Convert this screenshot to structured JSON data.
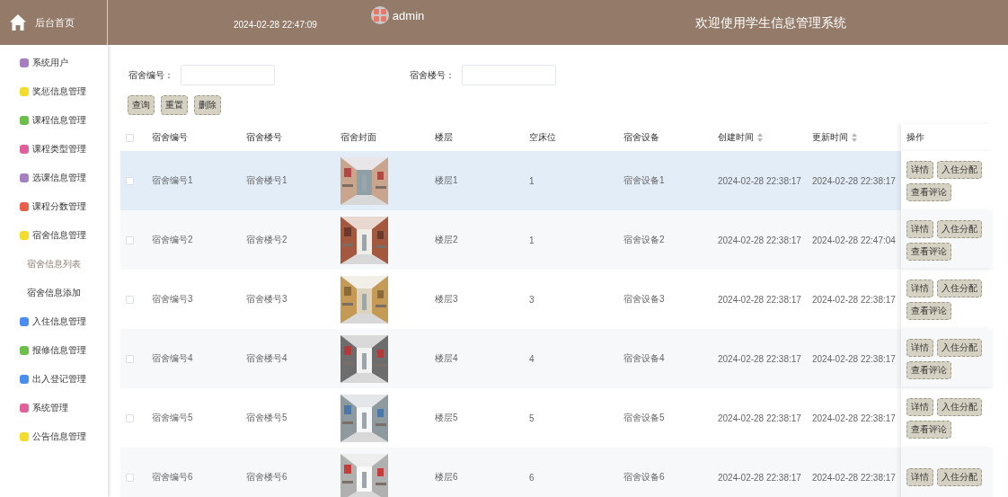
{
  "header": {
    "home_label": "后台首页",
    "datetime": "2024-02-28 22:47:09",
    "user": "admin",
    "title": "欢迎使用学生信息管理系统"
  },
  "sidebar": {
    "items": [
      {
        "label": "系统用户",
        "color": "#a57fc0"
      },
      {
        "label": "奖惩信息管理",
        "color": "#f2dc2e"
      },
      {
        "label": "课程信息管理",
        "color": "#6cc04a"
      },
      {
        "label": "课程类型管理",
        "color": "#e0609e"
      },
      {
        "label": "选课信息管理",
        "color": "#a57fc0"
      },
      {
        "label": "课程分数管理",
        "color": "#e8604c"
      },
      {
        "label": "宿舍信息管理",
        "color": "#f2dc2e",
        "children": [
          {
            "label": "宿舍信息列表",
            "selected": true
          },
          {
            "label": "宿舍信息添加",
            "selected": false
          }
        ]
      },
      {
        "label": "入住信息管理",
        "color": "#4a8df0"
      },
      {
        "label": "报修信息管理",
        "color": "#6cc04a"
      },
      {
        "label": "出入登记管理",
        "color": "#4a8df0"
      },
      {
        "label": "系统管理",
        "color": "#e0609e"
      },
      {
        "label": "公告信息管理",
        "color": "#f2dc2e"
      }
    ]
  },
  "search": {
    "fields": [
      {
        "label": "宿舍编号："
      },
      {
        "label": "宿舍楼号："
      }
    ],
    "buttons": [
      "查询",
      "重置",
      "删除"
    ]
  },
  "table": {
    "header_checked": false,
    "columns": [
      {
        "label": "宿舍编号",
        "sortable": false
      },
      {
        "label": "宿舍楼号",
        "sortable": false
      },
      {
        "label": "宿舍封面",
        "sortable": false
      },
      {
        "label": "楼层",
        "sortable": false
      },
      {
        "label": "空床位",
        "sortable": false
      },
      {
        "label": "宿舍设备",
        "sortable": false
      },
      {
        "label": "创建时间",
        "sortable": true
      },
      {
        "label": "更新时间",
        "sortable": true
      },
      {
        "label": "操作",
        "sortable": false
      }
    ],
    "rows": [
      {
        "checked": false,
        "highlighted": true,
        "cells": [
          "宿舍编号1",
          "宿舍楼号1",
          {
            "kind": "picture"
          },
          "楼层1",
          "1",
          "宿舍设备1",
          "2024-02-28 22:38:17",
          "2024-02-28 22:38:17",
          {
            "actions": [
              "详情",
              "入住分配",
              "查看评论"
            ]
          }
        ]
      },
      {
        "checked": false,
        "highlighted": false,
        "cells": [
          "宿舍编号2",
          "宿舍楼号2",
          {
            "kind": "picture"
          },
          "楼层2",
          "1",
          "宿舍设备2",
          "2024-02-28 22:38:17",
          "2024-02-28 22:47:04",
          {
            "actions": [
              "详情",
              "入住分配",
              "查看评论"
            ]
          }
        ]
      },
      {
        "checked": false,
        "highlighted": false,
        "cells": [
          "宿舍编号3",
          "宿舍楼号3",
          {
            "kind": "picture"
          },
          "楼层3",
          "3",
          "宿舍设备3",
          "2024-02-28 22:38:17",
          "2024-02-28 22:38:17",
          {
            "actions": [
              "详情",
              "入住分配",
              "查看评论"
            ]
          }
        ]
      },
      {
        "checked": false,
        "highlighted": false,
        "cells": [
          "宿舍编号4",
          "宿舍楼号4",
          {
            "kind": "picture"
          },
          "楼层4",
          "4",
          "宿舍设备4",
          "2024-02-28 22:38:17",
          "2024-02-28 22:38:17",
          {
            "actions": [
              "详情",
              "入住分配",
              "查看评论"
            ]
          }
        ]
      },
      {
        "checked": false,
        "highlighted": false,
        "cells": [
          "宿舍编号5",
          "宿舍楼号5",
          {
            "kind": "picture"
          },
          "楼层5",
          "5",
          "宿舍设备5",
          "2024-02-28 22:38:17",
          "2024-02-28 22:38:17",
          {
            "actions": [
              "详情",
              "入住分配",
              "查看评论"
            ]
          }
        ]
      },
      {
        "checked": false,
        "highlighted": false,
        "cells": [
          "宿舍编号6",
          "宿舍楼号6",
          {
            "kind": "picture"
          },
          "楼层6",
          "6",
          "宿舍设备6",
          "2024-02-28 22:38:17",
          "2024-02-28 22:38:17",
          {
            "actions": [
              "详情",
              "入住分配"
            ]
          }
        ]
      }
    ]
  }
}
